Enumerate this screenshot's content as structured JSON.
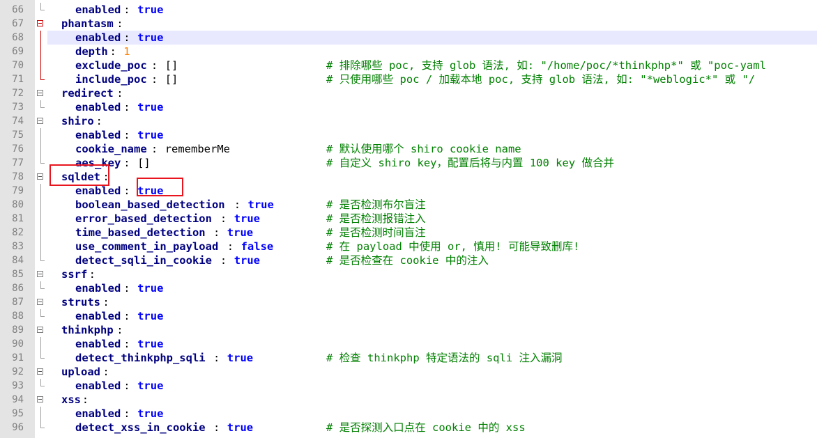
{
  "editor": {
    "highlight_color": "#e8141e",
    "lines": [
      {
        "no": "66",
        "indent": 2,
        "key": "enabled",
        "value": "true",
        "vtype": "bool",
        "comment": ""
      },
      {
        "no": "67",
        "indent": 1,
        "key": "phantasm",
        "value": "",
        "vtype": "",
        "comment": "",
        "fold": "red"
      },
      {
        "no": "68",
        "indent": 2,
        "key": "enabled",
        "value": "true",
        "vtype": "bool",
        "comment": "",
        "current": true
      },
      {
        "no": "69",
        "indent": 2,
        "key": "depth",
        "value": "1",
        "vtype": "num",
        "comment": ""
      },
      {
        "no": "70",
        "indent": 2,
        "key": "exclude_poc",
        "value": "[]",
        "vtype": "plain",
        "comment": "# 排除哪些 poc, 支持 glob 语法, 如: \"/home/poc/*thinkphp*\" 或 \"poc-yaml"
      },
      {
        "no": "71",
        "indent": 2,
        "key": "include_poc",
        "value": "[]",
        "vtype": "plain",
        "comment": "# 只使用哪些 poc / 加载本地 poc, 支持 glob 语法, 如: \"*weblogic*\" 或 \"/"
      },
      {
        "no": "72",
        "indent": 1,
        "key": "redirect",
        "value": "",
        "vtype": "",
        "comment": "",
        "fold": "gray"
      },
      {
        "no": "73",
        "indent": 2,
        "key": "enabled",
        "value": "true",
        "vtype": "bool",
        "comment": ""
      },
      {
        "no": "74",
        "indent": 1,
        "key": "shiro",
        "value": "",
        "vtype": "",
        "comment": "",
        "fold": "gray"
      },
      {
        "no": "75",
        "indent": 2,
        "key": "enabled",
        "value": "true",
        "vtype": "bool",
        "comment": ""
      },
      {
        "no": "76",
        "indent": 2,
        "key": "cookie_name",
        "value": "rememberMe",
        "vtype": "plain",
        "comment": "# 默认使用哪个 shiro cookie name"
      },
      {
        "no": "77",
        "indent": 2,
        "key": "aes_key",
        "value": "[]",
        "vtype": "plain",
        "comment": "# 自定义 shiro key，配置后将与内置 100 key 做合并"
      },
      {
        "no": "78",
        "indent": 1,
        "key": "sqldet",
        "value": "",
        "vtype": "",
        "comment": "",
        "fold": "gray"
      },
      {
        "no": "79",
        "indent": 2,
        "key": "enabled",
        "value": "true",
        "vtype": "bool",
        "comment": ""
      },
      {
        "no": "80",
        "indent": 2,
        "key": "boolean_based_detection",
        "value": "true",
        "vtype": "bool",
        "comment": "# 是否检测布尔盲注"
      },
      {
        "no": "81",
        "indent": 2,
        "key": "error_based_detection",
        "value": "true",
        "vtype": "bool",
        "comment": "# 是否检测报错注入"
      },
      {
        "no": "82",
        "indent": 2,
        "key": "time_based_detection",
        "value": "true",
        "vtype": "bool",
        "comment": "# 是否检测时间盲注"
      },
      {
        "no": "83",
        "indent": 2,
        "key": "use_comment_in_payload",
        "value": "false",
        "vtype": "bool",
        "comment": "# 在 payload 中使用 or, 慎用! 可能导致删库!"
      },
      {
        "no": "84",
        "indent": 2,
        "key": "detect_sqli_in_cookie",
        "value": "true",
        "vtype": "bool",
        "comment": "# 是否检查在 cookie 中的注入"
      },
      {
        "no": "85",
        "indent": 1,
        "key": "ssrf",
        "value": "",
        "vtype": "",
        "comment": "",
        "fold": "gray"
      },
      {
        "no": "86",
        "indent": 2,
        "key": "enabled",
        "value": "true",
        "vtype": "bool",
        "comment": ""
      },
      {
        "no": "87",
        "indent": 1,
        "key": "struts",
        "value": "",
        "vtype": "",
        "comment": "",
        "fold": "gray"
      },
      {
        "no": "88",
        "indent": 2,
        "key": "enabled",
        "value": "true",
        "vtype": "bool",
        "comment": ""
      },
      {
        "no": "89",
        "indent": 1,
        "key": "thinkphp",
        "value": "",
        "vtype": "",
        "comment": "",
        "fold": "gray"
      },
      {
        "no": "90",
        "indent": 2,
        "key": "enabled",
        "value": "true",
        "vtype": "bool",
        "comment": ""
      },
      {
        "no": "91",
        "indent": 2,
        "key": "detect_thinkphp_sqli",
        "value": "true",
        "vtype": "bool",
        "comment": "# 检查 thinkphp 特定语法的 sqli 注入漏洞"
      },
      {
        "no": "92",
        "indent": 1,
        "key": "upload",
        "value": "",
        "vtype": "",
        "comment": "",
        "fold": "gray"
      },
      {
        "no": "93",
        "indent": 2,
        "key": "enabled",
        "value": "true",
        "vtype": "bool",
        "comment": ""
      },
      {
        "no": "94",
        "indent": 1,
        "key": "xss",
        "value": "",
        "vtype": "",
        "comment": "",
        "fold": "gray"
      },
      {
        "no": "95",
        "indent": 2,
        "key": "enabled",
        "value": "true",
        "vtype": "bool",
        "comment": ""
      },
      {
        "no": "96",
        "indent": 2,
        "key": "detect_xss_in_cookie",
        "value": "true",
        "vtype": "bool",
        "comment": "# 是否探测入口点在 cookie 中的 xss"
      }
    ]
  }
}
